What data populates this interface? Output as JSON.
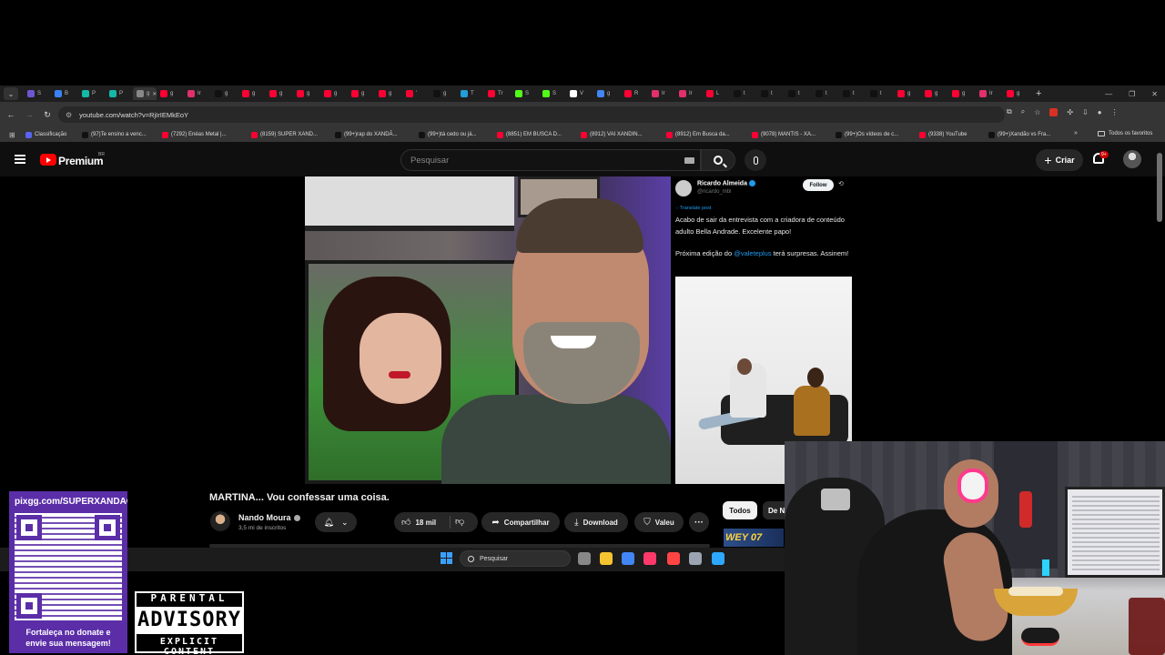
{
  "browser": {
    "tabs": [
      {
        "letter": "S",
        "color": "#6e56cf"
      },
      {
        "letter": "B",
        "color": "#3b82f6"
      },
      {
        "letter": "P",
        "color": "#14b8a6"
      },
      {
        "letter": "P",
        "color": "#14b8a6"
      },
      {
        "letter": "g",
        "color": "#888888",
        "active": true
      },
      {
        "letter": "g",
        "color": "#ff0033"
      },
      {
        "letter": "Ir",
        "color": "#e1306c"
      },
      {
        "letter": "g",
        "color": "#111111"
      },
      {
        "letter": "g",
        "color": "#ff0033"
      },
      {
        "letter": "g",
        "color": "#ff0033"
      },
      {
        "letter": "g",
        "color": "#ff0033"
      },
      {
        "letter": "g",
        "color": "#ff0033"
      },
      {
        "letter": "g",
        "color": "#ff0033"
      },
      {
        "letter": "g",
        "color": "#ff0033"
      },
      {
        "letter": "'",
        "color": "#ff0033"
      },
      {
        "letter": "g",
        "color": "#111111"
      },
      {
        "letter": "T",
        "color": "#229ed9"
      },
      {
        "letter": "Tr",
        "color": "#ff0033"
      },
      {
        "letter": "S",
        "color": "#53fc18"
      },
      {
        "letter": "S",
        "color": "#53fc18"
      },
      {
        "letter": "V",
        "color": "#ffffff"
      },
      {
        "letter": "g",
        "color": "#4285f4"
      },
      {
        "letter": "R",
        "color": "#ff0033"
      },
      {
        "letter": "Ir",
        "color": "#e1306c"
      },
      {
        "letter": "Ir",
        "color": "#e1306c"
      },
      {
        "letter": "L",
        "color": "#ff0033"
      },
      {
        "letter": "t",
        "color": "#111111"
      },
      {
        "letter": "t",
        "color": "#111111"
      },
      {
        "letter": "t",
        "color": "#111111"
      },
      {
        "letter": "t",
        "color": "#111111"
      },
      {
        "letter": "t",
        "color": "#111111"
      },
      {
        "letter": "t",
        "color": "#111111"
      },
      {
        "letter": "g",
        "color": "#ff0033"
      },
      {
        "letter": "g",
        "color": "#ff0033"
      },
      {
        "letter": "g",
        "color": "#ff0033"
      },
      {
        "letter": "Ir",
        "color": "#e1306c"
      },
      {
        "letter": "g",
        "color": "#ff0033"
      }
    ],
    "url": "youtube.com/watch?v=RjIrIEMkEoY",
    "bookmarks": [
      {
        "label": "Classificação",
        "color": "#5865f2"
      },
      {
        "label": "(97)Te ensino a venc...",
        "color": "#111111"
      },
      {
        "label": "(7292) Enéas Metal |...",
        "color": "#ff0033"
      },
      {
        "label": "(8159) SUPER XAND...",
        "color": "#ff0033"
      },
      {
        "label": "(99+)rap do XANDÃ...",
        "color": "#111111"
      },
      {
        "label": "(99+)tá cedo ou já...",
        "color": "#111111"
      },
      {
        "label": "(8851) EM BUSCA D...",
        "color": "#ff0033"
      },
      {
        "label": "(8912) VAI XANDIN...",
        "color": "#ff0033"
      },
      {
        "label": "(8912) Em Busca da...",
        "color": "#ff0033"
      },
      {
        "label": "(9078) MANTIS - XA...",
        "color": "#ff0033"
      },
      {
        "label": "(99+)Os vídeos de c...",
        "color": "#111111"
      },
      {
        "label": "(9338) YouTube",
        "color": "#ff0033"
      },
      {
        "label": "(99+)Xandão vs Fra...",
        "color": "#111111"
      }
    ],
    "bookmarks_more": "»",
    "all_favorites": "Todos os favoritos"
  },
  "youtube": {
    "brand": "Premium",
    "country": "BR",
    "search_placeholder": "Pesquisar",
    "create_label": "Criar",
    "notif_badge": "9+",
    "video_title": "MARTINA... Vou confessar uma coisa.",
    "channel_name": "Nando Moura",
    "subscribers": "3,5 mi de inscritos",
    "likes": "18 mil",
    "share_label": "Compartilhar",
    "download_label": "Download",
    "thanks_label": "Valeu",
    "chip_all": "Todos",
    "chip_de": "De N",
    "thumb_text": "WEY 07"
  },
  "tweet": {
    "name": "Ricardo Almeida",
    "handle": "@ricardo_mbl",
    "follow": "Follow",
    "translate": "Translate post",
    "text1": "Acabo de sair da entrevista com a criadora de conteúdo adulto Bella Andrade. Excelente papo!",
    "text2_before": "Próxima edição do ",
    "mention": "@valeteplus",
    "text2_after": " terá surpresas. Assinem!"
  },
  "taskbar": {
    "search_label": "Pesquisar",
    "icons": [
      {
        "name": "task-view-icon",
        "color": "#888888"
      },
      {
        "name": "file-explorer-icon",
        "color": "#f4c430"
      },
      {
        "name": "chrome-icon",
        "color": "#4285f4"
      },
      {
        "name": "steam-icon",
        "color": "#ff3a6a"
      },
      {
        "name": "obs-icon",
        "color": "#ff4444"
      },
      {
        "name": "settings-icon",
        "color": "#9aa4b2"
      },
      {
        "name": "app-icon",
        "color": "#2ea8ff"
      }
    ]
  },
  "donate": {
    "url": "pixgg.com/SUPERXANDAO",
    "line1": "Fortaleça no donate e",
    "line2": "envie sua mensagem!"
  },
  "advisory": {
    "top": "PARENTAL",
    "mid": "ADVISORY",
    "bottom": "EXPLICIT CONTENT"
  }
}
